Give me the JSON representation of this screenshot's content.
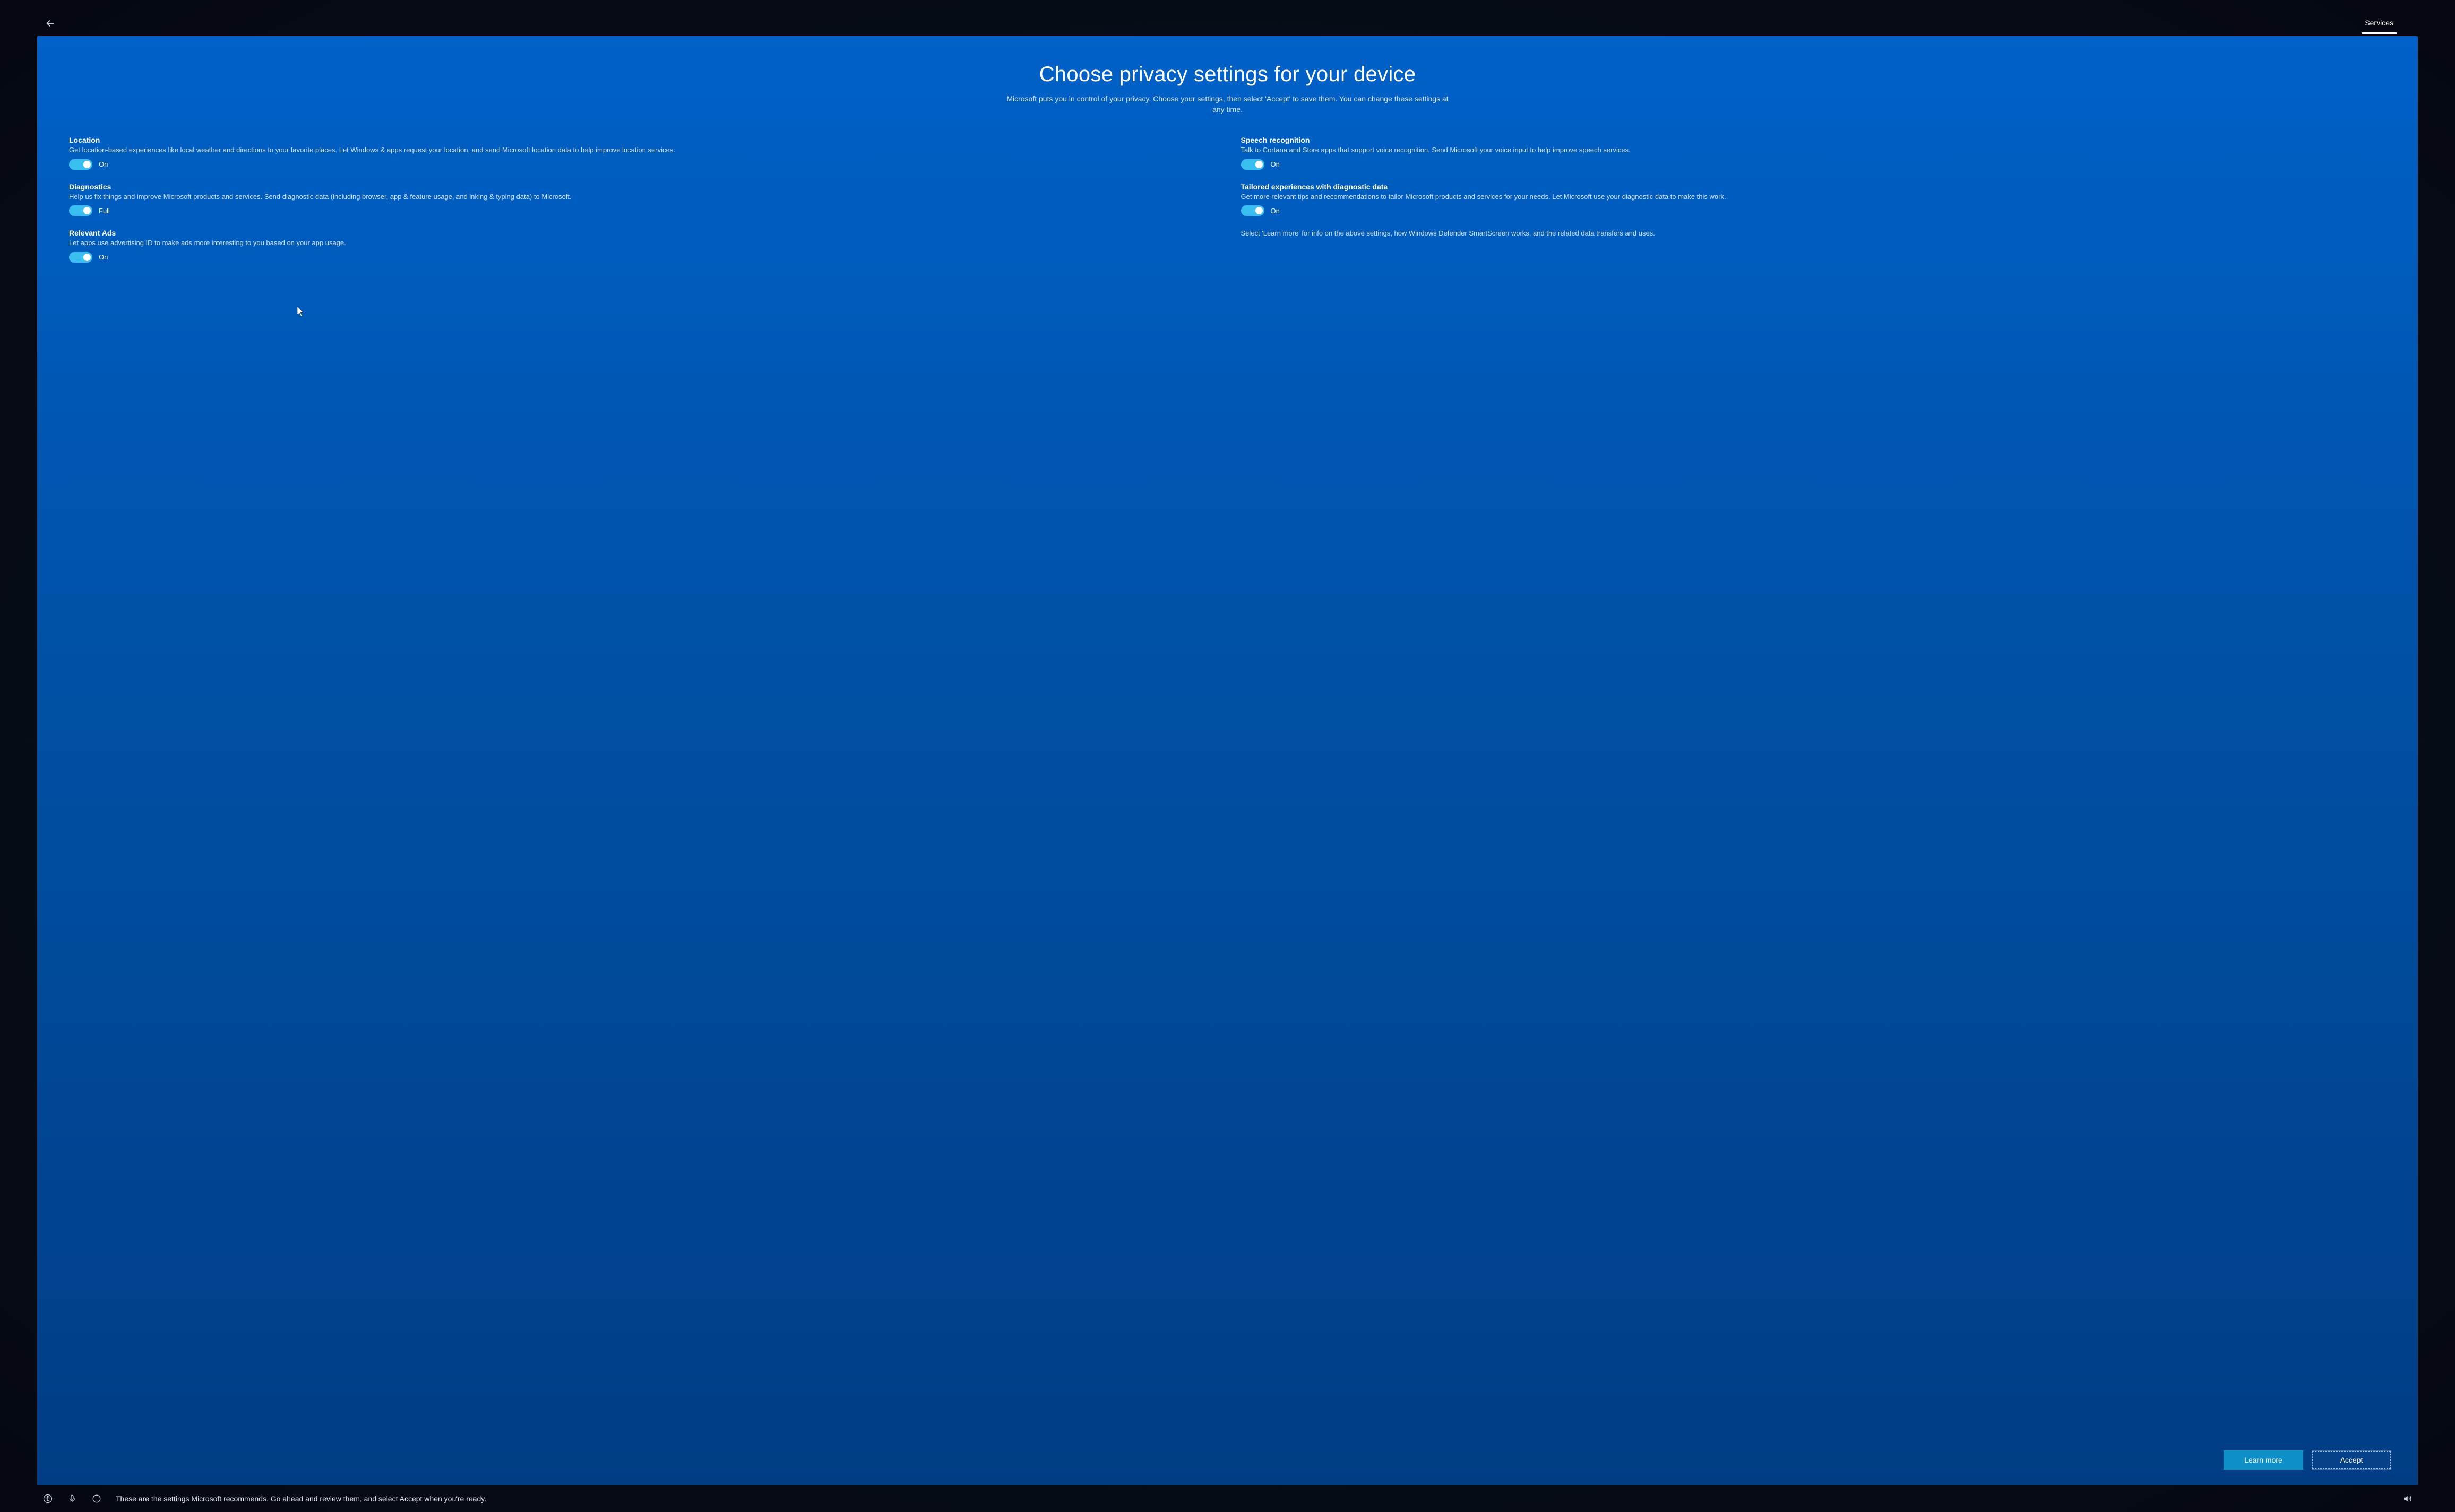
{
  "header": {
    "active_tab": "Services"
  },
  "page": {
    "title": "Choose privacy settings for your device",
    "subtitle": "Microsoft puts you in control of your privacy. Choose your settings, then select 'Accept' to save them. You can change these settings at any time."
  },
  "settings": {
    "location": {
      "title": "Location",
      "desc": "Get location-based experiences like local weather and directions to your favorite places. Let Windows & apps request your location, and send Microsoft location data to help improve location services.",
      "state": "On"
    },
    "diagnostics": {
      "title": "Diagnostics",
      "desc": "Help us fix things and improve Microsoft products and services. Send diagnostic data (including browser, app & feature usage, and inking & typing data) to Microsoft.",
      "state": "Full"
    },
    "ads": {
      "title": "Relevant Ads",
      "desc": "Let apps use advertising ID to make ads more interesting to you based on your app usage.",
      "state": "On"
    },
    "speech": {
      "title": "Speech recognition",
      "desc": "Talk to Cortana and Store apps that support voice recognition. Send Microsoft your voice input to help improve speech services.",
      "state": "On"
    },
    "tailored": {
      "title": "Tailored experiences with diagnostic data",
      "desc": "Get more relevant tips and recommendations to tailor Microsoft products and services for your needs. Let Microsoft use your diagnostic data to make this work.",
      "state": "On"
    },
    "info": "Select 'Learn more' for info on the above settings, how Windows Defender SmartScreen works, and the related data transfers and uses."
  },
  "buttons": {
    "learn_more": "Learn more",
    "accept": "Accept"
  },
  "bottombar": {
    "hint": "These are the settings Microsoft recommends. Go ahead and review them, and select Accept when you're ready."
  }
}
